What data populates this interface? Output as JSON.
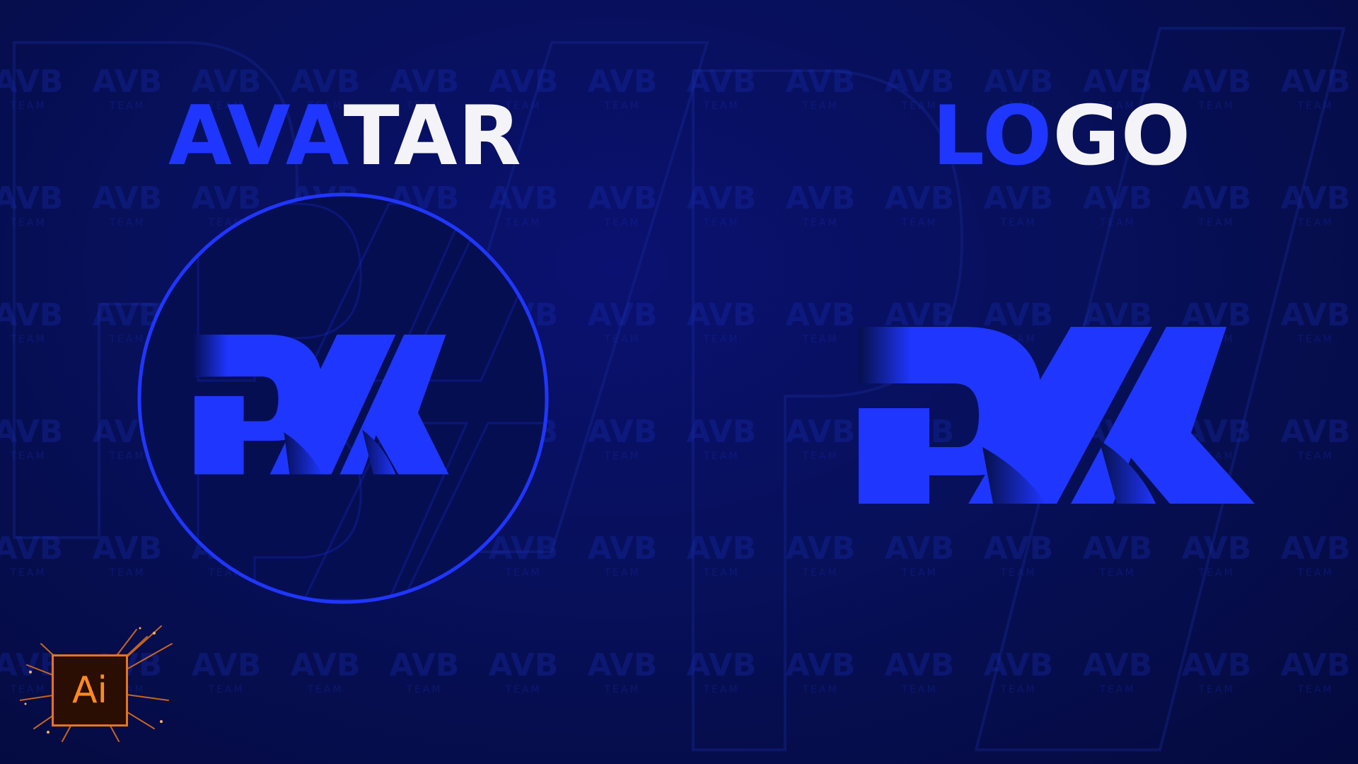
{
  "colors": {
    "accent": "#1f36ff",
    "heading_rest": "#f4f4f8",
    "background_dark": "#040a3d",
    "ai_orange": "#ff8a1f"
  },
  "headings": {
    "avatar": {
      "accent": "AVA",
      "rest": "TAR"
    },
    "logo": {
      "accent": "LO",
      "rest": "GO"
    }
  },
  "watermark": {
    "top": "AVB",
    "bottom": "TEAM"
  },
  "emblem": {
    "monogram": "PM"
  },
  "badge": {
    "label": "Ai",
    "icon": "adobe-illustrator-icon"
  }
}
